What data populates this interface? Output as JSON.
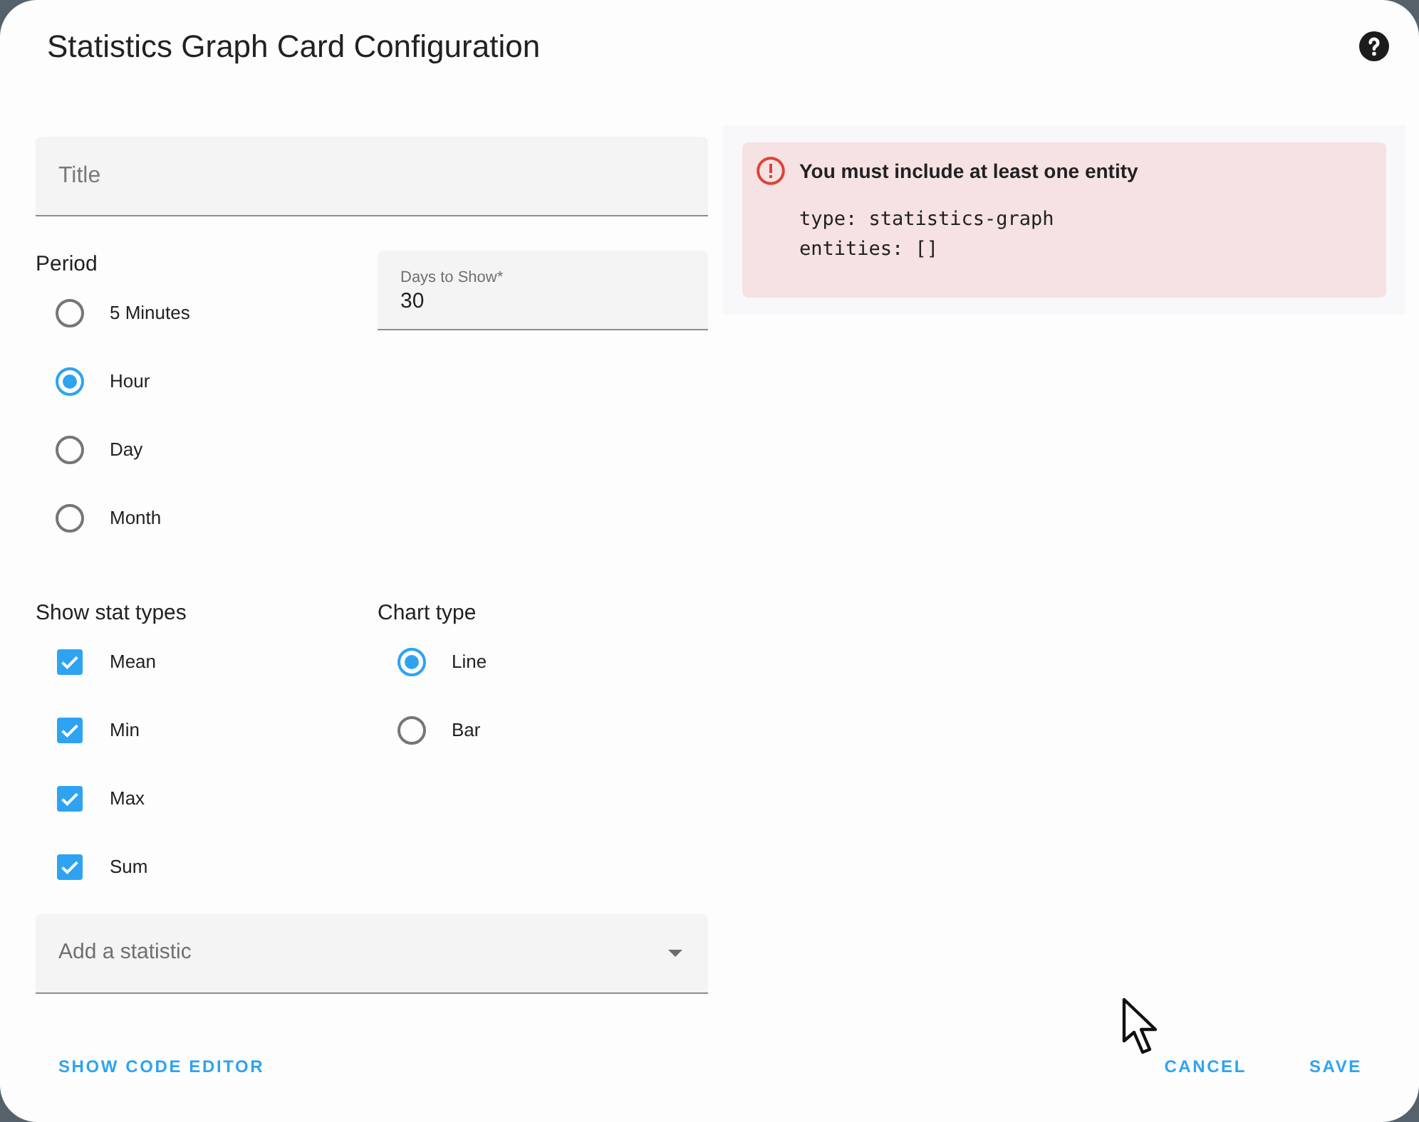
{
  "dialog": {
    "title": "Statistics Graph Card Configuration"
  },
  "title_field": {
    "placeholder": "Title"
  },
  "period": {
    "label": "Period",
    "options": [
      {
        "label": "5 Minutes",
        "selected": false
      },
      {
        "label": "Hour",
        "selected": true
      },
      {
        "label": "Day",
        "selected": false
      },
      {
        "label": "Month",
        "selected": false
      }
    ]
  },
  "days_to_show": {
    "label": "Days to Show*",
    "value": "30"
  },
  "stat_types": {
    "label": "Show stat types",
    "options": [
      {
        "label": "Mean",
        "checked": true
      },
      {
        "label": "Min",
        "checked": true
      },
      {
        "label": "Max",
        "checked": true
      },
      {
        "label": "Sum",
        "checked": true
      }
    ]
  },
  "chart_type": {
    "label": "Chart type",
    "options": [
      {
        "label": "Line",
        "selected": true
      },
      {
        "label": "Bar",
        "selected": false
      }
    ]
  },
  "statistic_picker": {
    "placeholder": "Add a statistic"
  },
  "error": {
    "title": "You must include at least one entity",
    "code_lines": [
      "type: statistics-graph",
      "entities: []"
    ]
  },
  "buttons": {
    "left": [
      {
        "label": "SHOW CODE EDITOR"
      }
    ],
    "right": [
      {
        "label": "CANCEL"
      },
      {
        "label": "SAVE"
      }
    ]
  }
}
